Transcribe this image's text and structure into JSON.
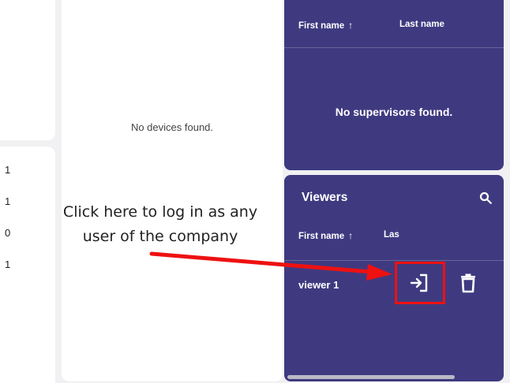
{
  "left_counts": [
    "1",
    "1",
    "0",
    "1"
  ],
  "devices": {
    "empty_text": "No devices found."
  },
  "supervisors": {
    "columns": {
      "first_name": "First name",
      "last_name": "Last name"
    },
    "empty_text": "No supervisors found."
  },
  "viewers": {
    "title": "Viewers",
    "columns": {
      "first_name": "First name",
      "last_name_truncated": "Las"
    },
    "rows": [
      {
        "name": "viewer 1"
      }
    ]
  },
  "annotation": {
    "line1": "Click here to log in as any",
    "line2": "user of the company"
  },
  "colors": {
    "panel_purple": "#3f3a80",
    "annotation_red": "#ee1111",
    "background": "#f1f1f3"
  },
  "icons": {
    "sort": "arrow-up-icon",
    "search": "search-icon",
    "login": "login-icon",
    "delete": "trash-icon"
  }
}
